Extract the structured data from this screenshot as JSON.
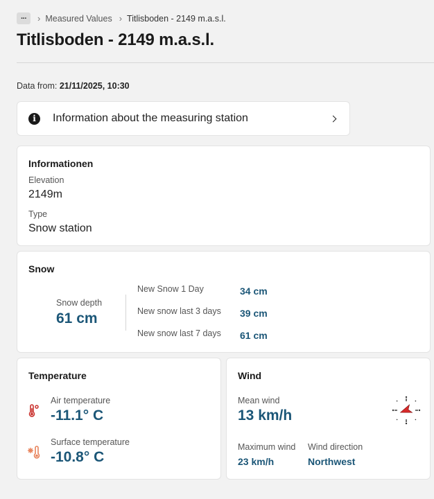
{
  "breadcrumb": {
    "more": "···",
    "items": [
      "Measured Values",
      "Titlisboden - 2149 m.a.s.l."
    ]
  },
  "page_title": "Titlisboden - 2149 m.a.s.l.",
  "data_from": {
    "label": "Data from:",
    "value": "21/11/2025, 10:30"
  },
  "info_button": {
    "label": "Information about the measuring station",
    "icon": "info-icon"
  },
  "information": {
    "title": "Informationen",
    "elevation_label": "Elevation",
    "elevation_value": "2149m",
    "type_label": "Type",
    "type_value": "Snow station"
  },
  "snow": {
    "title": "Snow",
    "depth_label": "Snow depth",
    "depth_value": "61 cm",
    "rows": [
      {
        "label": "New Snow 1 Day",
        "value": "34 cm"
      },
      {
        "label": "New snow last 3 days",
        "value": "39 cm"
      },
      {
        "label": "New snow last 7 days",
        "value": "61 cm"
      }
    ]
  },
  "temperature": {
    "title": "Temperature",
    "air_label": "Air temperature",
    "air_value": "-11.1° C",
    "surface_label": "Surface temperature",
    "surface_value": "-10.8° C"
  },
  "wind": {
    "title": "Wind",
    "mean_label": "Mean wind",
    "mean_value": "13 km/h",
    "max_label": "Maximum wind",
    "max_value": "23 km/h",
    "direction_label": "Wind direction",
    "direction_value": "Northwest"
  },
  "colors": {
    "accent_value": "#1b5677",
    "air_icon": "#c9302c",
    "surface_icon": "#e8825a",
    "compass_arrow": "#d72a2a"
  }
}
